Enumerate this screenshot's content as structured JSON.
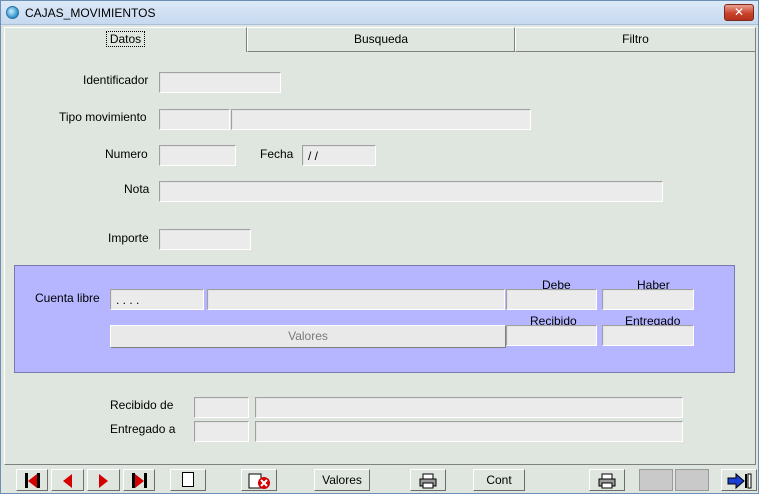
{
  "window": {
    "title": "CAJAS_MOVIMIENTOS",
    "close_glyph": "✕"
  },
  "tabs": [
    {
      "label": "Datos",
      "active": true
    },
    {
      "label": "Busqueda",
      "active": false
    },
    {
      "label": "Filtro",
      "active": false
    }
  ],
  "form": {
    "identificador": {
      "label": "Identificador",
      "value": ""
    },
    "tipo_movimiento": {
      "label": "Tipo movimiento",
      "code": "",
      "description": ""
    },
    "numero": {
      "label": "Numero",
      "value": ""
    },
    "fecha": {
      "label": "Fecha",
      "value": "/ /"
    },
    "nota": {
      "label": "Nota",
      "value": ""
    },
    "importe": {
      "label": "Importe",
      "value": ""
    }
  },
  "panel": {
    "cuenta_label": "Cuenta libre",
    "cuenta_code": ". . . .",
    "cuenta_desc": "",
    "debe_label": "Debe",
    "haber_label": "Haber",
    "recibido_label": "Recibido",
    "entregado_label": "Entregado",
    "debe_value": "",
    "haber_value": "",
    "recibido_value": "",
    "entregado_value": "",
    "valores_button": "Valores",
    "accent_color": "#b5b6ff"
  },
  "lower": {
    "recibido_de_label": "Recibido de",
    "entregado_a_label": "Entregado a"
  },
  "toolbar": {
    "valores_label": "Valores",
    "cont_label": "Cont",
    "icons": [
      "first-record-icon",
      "prev-record-icon",
      "next-record-icon",
      "last-record-icon",
      "new-record-icon",
      "delete-record-icon",
      "print-icon",
      "print-icon",
      "exit-icon"
    ]
  }
}
